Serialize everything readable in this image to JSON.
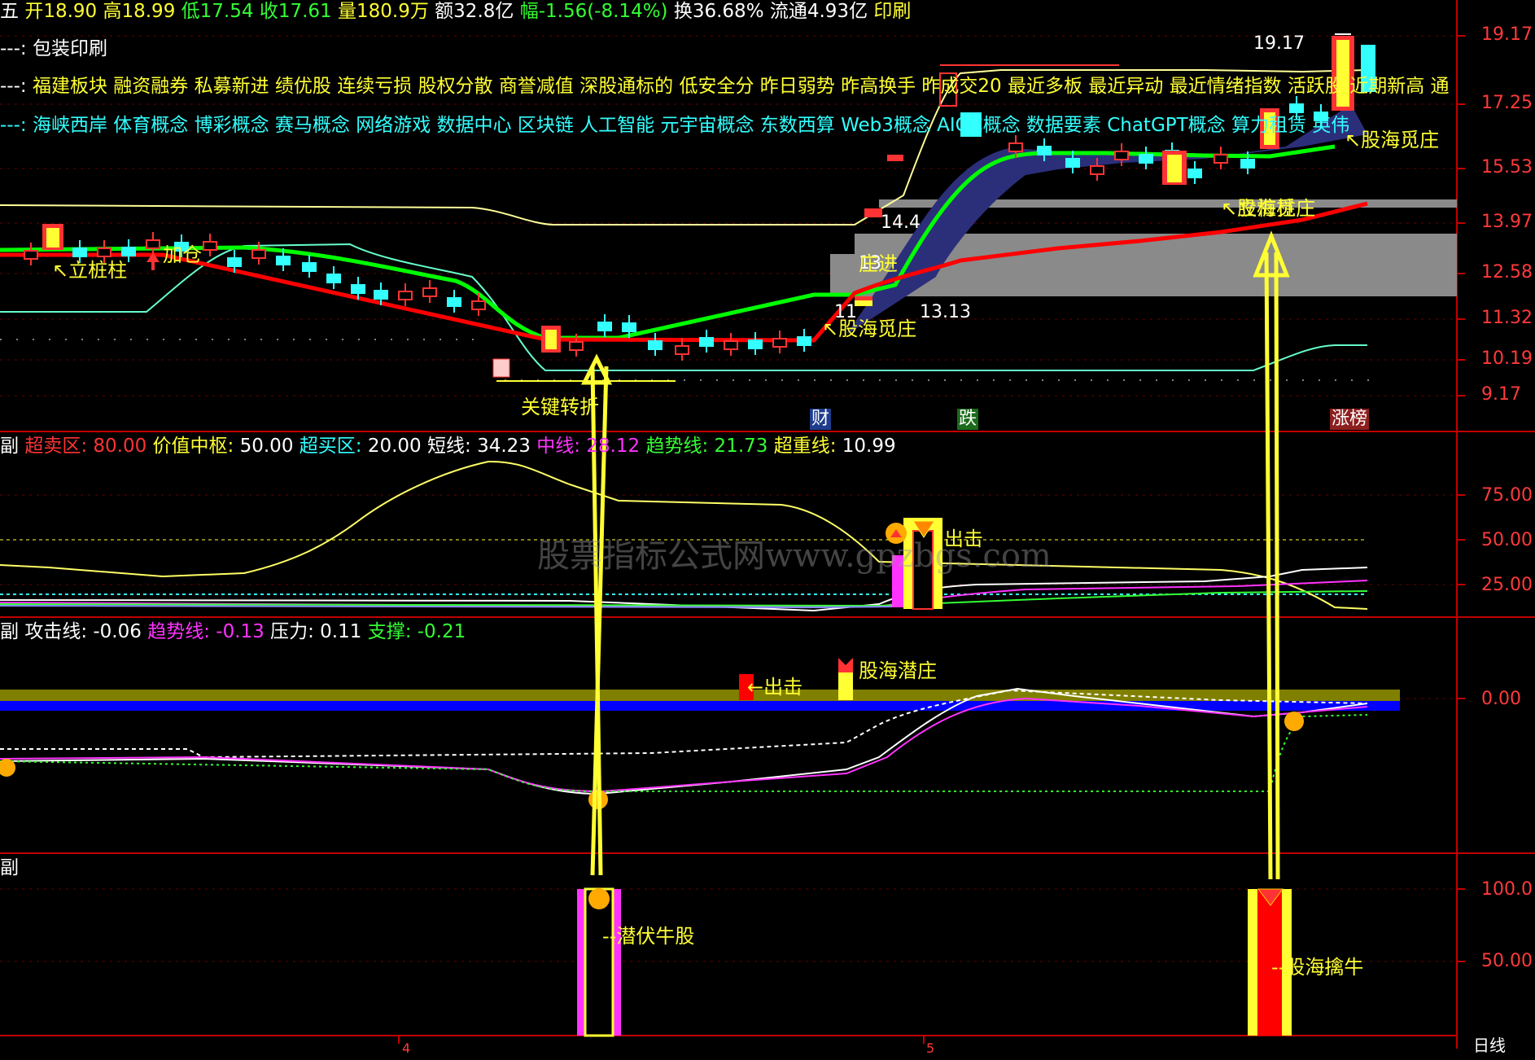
{
  "header": {
    "prefix": "五",
    "open": "开18.90",
    "high": "高18.99",
    "low": "低17.54",
    "close": "收17.61",
    "volume": "量180.9万",
    "amount": "额32.8亿",
    "change": "幅-1.56(-8.14%)",
    "turnover": "换36.68%",
    "float_cap": "流通4.93亿",
    "industry": "印刷"
  },
  "concept_rows": [
    {
      "prefix": "---:",
      "text": "包装印刷",
      "color": "#ffffff"
    },
    {
      "prefix": "---:",
      "text": "福建板块 融资融券 私募新进 绩优股 连续亏损 股权分散 商誉减值 深股通标的 低安全分 昨日弱势 昨高换手 昨成交20 最近多板 最近异动 最近情绪指数 活跃股 近期新高 通",
      "color": "#ffff33"
    },
    {
      "prefix": "---:",
      "text": "海峡西岸 体育概念 博彩概念 赛马概念 网络游戏 数据中心 区块链 人工智能 元宇宙概念 东数西算 Web3概念 AIGC概念 数据要素 ChatGPT概念 算力租赁 英伟",
      "color": "#33ffff"
    }
  ],
  "price_axis": [
    "19.17",
    "17.25",
    "15.53",
    "13.97",
    "12.58",
    "11.32",
    "10.19",
    "9.17"
  ],
  "price_labels": {
    "high_mark": "19.17",
    "mid1": "14.4",
    "mid2": "13",
    "mid3": "11",
    "low_mark": "13.13"
  },
  "chart_annotations": [
    "↖立桩柱",
    "加仓",
    "↖股海觅庄",
    "庄进",
    "↖股海觅庄",
    "↖立桩柱",
    "↖股海觅庄",
    "关键转折"
  ],
  "events": [
    {
      "label": "财",
      "bg": "#1f3d8c"
    },
    {
      "label": "跌",
      "bg": "#1b6b1b"
    },
    {
      "label": "涨榜",
      "bg": "#8c1f1f"
    }
  ],
  "panel2": {
    "prefix": "副",
    "items": [
      {
        "name": "超卖区:",
        "value": "80.00",
        "color": "#ff3333"
      },
      {
        "name": "价值中枢:",
        "value": "50.00",
        "color": "#ffff33"
      },
      {
        "name": "超买区:",
        "value": "20.00",
        "color": "#33ffff"
      },
      {
        "name": "短线:",
        "value": "34.23",
        "color": "#ffffff"
      },
      {
        "name": "中线:",
        "value": "28.12",
        "color": "#ff33ff"
      },
      {
        "name": "趋势线:",
        "value": "21.73",
        "color": "#33ff33"
      },
      {
        "name": "超重线:",
        "value": "10.99",
        "color": "#ffff33"
      }
    ],
    "axis": [
      "75.00",
      "50.00",
      "25.00"
    ],
    "signal": "出击"
  },
  "panel3": {
    "prefix": "副",
    "items": [
      {
        "name": "攻击线:",
        "value": "-0.06",
        "color": "#ffffff"
      },
      {
        "name": "趋势线:",
        "value": "-0.13",
        "color": "#ff33ff"
      },
      {
        "name": "压力:",
        "value": "0.11",
        "color": "#ffffff"
      },
      {
        "name": "支撑:",
        "value": "-0.21",
        "color": "#33ff33"
      }
    ],
    "axis": [
      "0.00"
    ],
    "signal_attack": "←出击",
    "signal_lurk": "股海潜庄"
  },
  "panel4": {
    "prefix": "副",
    "axis": [
      "100.0",
      "50.00"
    ],
    "label_latent": "潜伏牛股",
    "label_catch": "股海擒牛"
  },
  "watermark": "股票指标公式网www.gpzbgs.com",
  "period_label": "日线",
  "month_marks": [
    "4",
    "5"
  ],
  "colors": {
    "up": "#ff3333",
    "down": "#33ffff",
    "ma_green": "#00ff00",
    "ma_red": "#ff0000",
    "band": "#2b2f7a",
    "arrow": "#ffff33",
    "grid": "#b00000"
  }
}
